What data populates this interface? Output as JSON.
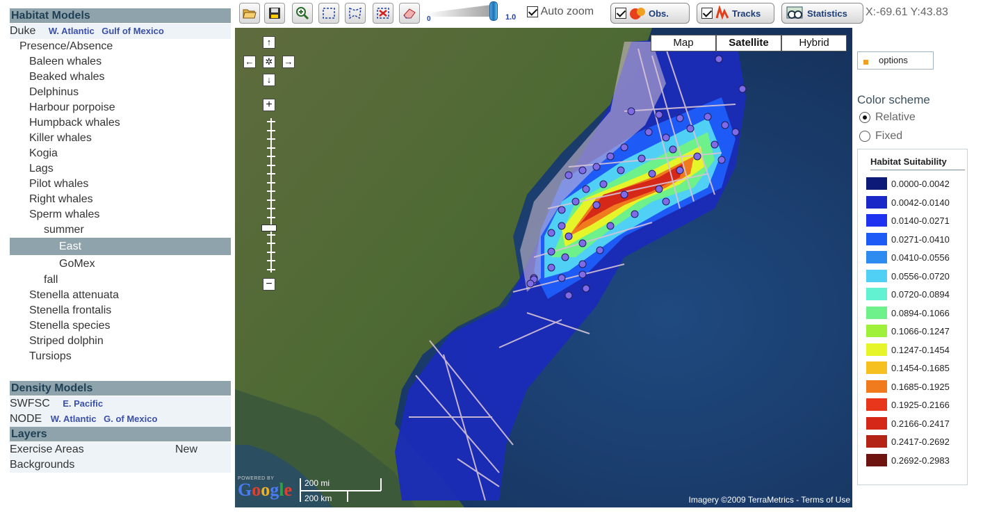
{
  "left_panel": {
    "habitat_header": "Habitat Models",
    "duke": {
      "label": "Duke",
      "links": [
        "W. Atlantic",
        "Gulf of Mexico"
      ]
    },
    "tree": [
      {
        "label": "Presence/Absence",
        "level": 0
      },
      {
        "label": "Baleen whales",
        "level": 1
      },
      {
        "label": "Beaked whales",
        "level": 1
      },
      {
        "label": "Delphinus",
        "level": 1
      },
      {
        "label": "Harbour porpoise",
        "level": 1
      },
      {
        "label": "Humpback whales",
        "level": 1
      },
      {
        "label": "Killer whales",
        "level": 1
      },
      {
        "label": "Kogia",
        "level": 1
      },
      {
        "label": "Lags",
        "level": 1
      },
      {
        "label": "Pilot whales",
        "level": 1
      },
      {
        "label": "Right whales",
        "level": 1
      },
      {
        "label": "Sperm whales",
        "level": 1
      },
      {
        "label": "summer",
        "level": 2
      },
      {
        "label": "East",
        "level": 3,
        "selected": true
      },
      {
        "label": "GoMex",
        "level": 3
      },
      {
        "label": "fall",
        "level": 2
      },
      {
        "label": "Stenella attenuata",
        "level": 1
      },
      {
        "label": "Stenella frontalis",
        "level": 1
      },
      {
        "label": "Stenella species",
        "level": 1
      },
      {
        "label": "Striped dolphin",
        "level": 1
      },
      {
        "label": "Tursiops",
        "level": 1
      }
    ],
    "density_header": "Density Models",
    "swfsc": {
      "label": "SWFSC",
      "links": [
        "E. Pacific"
      ]
    },
    "node": {
      "label": "NODE",
      "links": [
        "W. Atlantic",
        "G. of Mexico"
      ]
    },
    "layers_header": "Layers",
    "exercise_areas": "Exercise Areas",
    "new_badge": "New",
    "backgrounds": "Backgrounds"
  },
  "toolbar": {
    "icons": [
      "open-folder-icon",
      "save-disk-icon",
      "zoom-in-icon",
      "select-rectangle-icon",
      "select-polygon-icon",
      "clear-selection-icon",
      "eraser-icon"
    ],
    "slider_min": "0",
    "slider_max": "1.0",
    "opacity_value": 1.0,
    "auto_zoom_label": "Auto zoom",
    "auto_zoom_checked": true,
    "obs_label": "Obs.",
    "obs_checked": true,
    "tracks_label": "Tracks",
    "tracks_checked": true,
    "statistics_label": "Statistics",
    "coords": "X:-69.61 Y:43.83"
  },
  "map": {
    "map_types": [
      "Map",
      "Satellite",
      "Hybrid"
    ],
    "active_map_type": "Satellite",
    "nav": {
      "up": "↑",
      "left": "←",
      "center": "✲",
      "right": "→",
      "down": "↓",
      "zoom_in": "+",
      "zoom_out": "−"
    },
    "powered_by": "POWERED BY",
    "google": "Google",
    "scale_mi": "200 mi",
    "scale_km": "200 km",
    "attribution": "Imagery ©2009 TerraMetrics - Terms of Use"
  },
  "right_panel": {
    "options_label": "options",
    "color_scheme_title": "Color scheme",
    "relative_label": "Relative",
    "fixed_label": "Fixed",
    "selected_scheme": "Relative",
    "legend_title": "Habitat Suitability",
    "legend": [
      {
        "range": "0.0000-0.0042",
        "color": "#0e1a78"
      },
      {
        "range": "0.0042-0.0140",
        "color": "#1a28c8"
      },
      {
        "range": "0.0140-0.0271",
        "color": "#1e32f0"
      },
      {
        "range": "0.0271-0.0410",
        "color": "#1e5af5"
      },
      {
        "range": "0.0410-0.0556",
        "color": "#2e8cf0"
      },
      {
        "range": "0.0556-0.0720",
        "color": "#50d0f5"
      },
      {
        "range": "0.0720-0.0894",
        "color": "#62f2d2"
      },
      {
        "range": "0.0894-0.1066",
        "color": "#6ef08a"
      },
      {
        "range": "0.1066-0.1247",
        "color": "#9ef03a"
      },
      {
        "range": "0.1247-0.1454",
        "color": "#e6f52a"
      },
      {
        "range": "0.1454-0.1685",
        "color": "#f5c020"
      },
      {
        "range": "0.1685-0.1925",
        "color": "#f07a1e"
      },
      {
        "range": "0.1925-0.2166",
        "color": "#e8361c"
      },
      {
        "range": "0.2166-0.2417",
        "color": "#d62818"
      },
      {
        "range": "0.2417-0.2692",
        "color": "#b42416"
      },
      {
        "range": "0.2692-0.2983",
        "color": "#6e1410"
      }
    ]
  }
}
